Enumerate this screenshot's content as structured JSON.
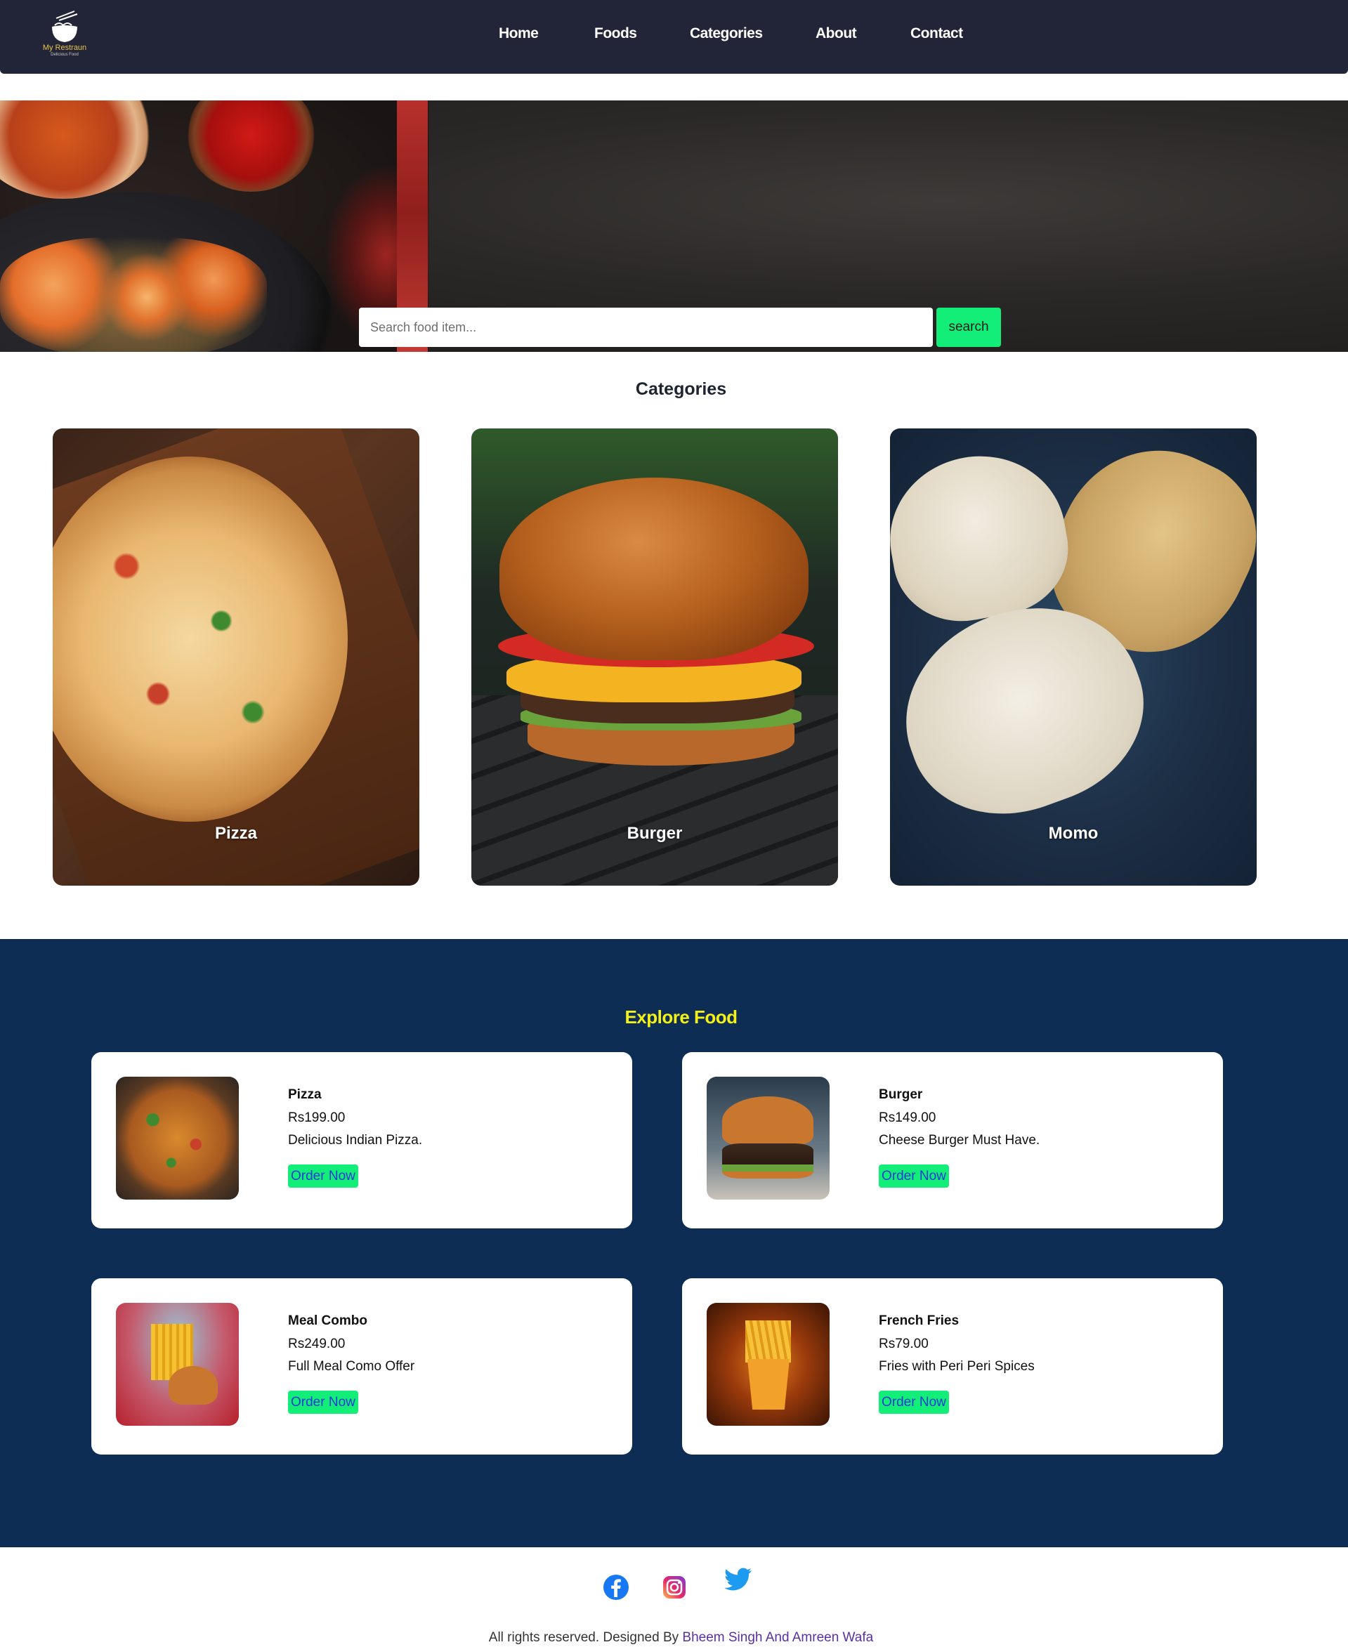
{
  "nav": {
    "logo": {
      "brand": "My Restraun",
      "tagline": "Delicious Food"
    },
    "links": [
      "Home",
      "Foods",
      "Categories",
      "About",
      "Contact"
    ]
  },
  "search": {
    "placeholder": "Search food item...",
    "button_label": "search"
  },
  "categories": {
    "title": "Categories",
    "items": [
      {
        "label": "Pizza"
      },
      {
        "label": "Burger"
      },
      {
        "label": "Momo"
      }
    ]
  },
  "explore": {
    "title": "Explore Food",
    "items": [
      {
        "name": "Pizza",
        "price": "Rs199.00",
        "description": "Delicious Indian Pizza.",
        "button": "Order Now"
      },
      {
        "name": "Burger",
        "price": "Rs149.00",
        "description": "Cheese Burger Must Have.",
        "button": "Order Now"
      },
      {
        "name": "Meal Combo",
        "price": "Rs249.00",
        "description": "Full Meal Como Offer",
        "button": "Order Now"
      },
      {
        "name": "French Fries",
        "price": "Rs79.00",
        "description": "Fries with Peri Peri Spices",
        "button": "Order Now"
      }
    ]
  },
  "footer": {
    "social": [
      "facebook-icon",
      "instagram-icon",
      "twitter-icon"
    ],
    "text": "All rights reserved. Designed By ",
    "designers": "Bheem Singh And Amreen Wafa"
  },
  "colors": {
    "nav_bg": "#222438",
    "accent_green": "#12ee78",
    "explore_bg": "#0d2d55",
    "explore_title": "#f3f117",
    "order_text": "#1d3cd8",
    "footer_link": "#5b2fa3"
  }
}
